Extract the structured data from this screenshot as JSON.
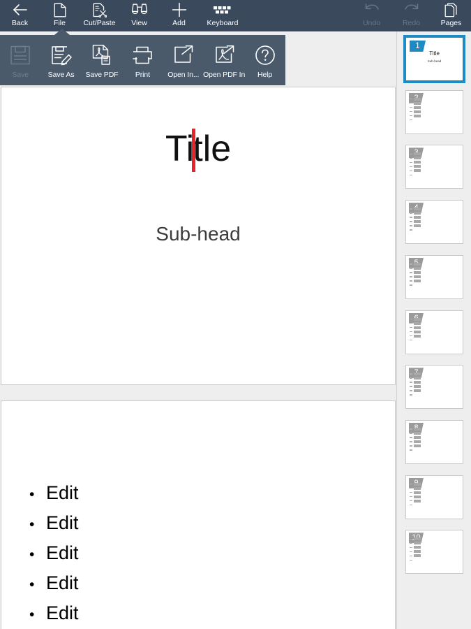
{
  "toolbar": {
    "left_items": [
      {
        "label": "Back",
        "icon": "arrow-left-icon",
        "disabled": false
      },
      {
        "label": "File",
        "icon": "document-icon",
        "disabled": false
      },
      {
        "label": "Cut/Paste",
        "icon": "cut-paste-icon",
        "disabled": false
      },
      {
        "label": "View",
        "icon": "binoculars-icon",
        "disabled": false
      },
      {
        "label": "Add",
        "icon": "plus-icon",
        "disabled": false
      },
      {
        "label": "Keyboard",
        "icon": "keyboard-icon",
        "disabled": false
      }
    ],
    "right_items": [
      {
        "label": "Undo",
        "icon": "undo-arrow-icon",
        "disabled": true
      },
      {
        "label": "Redo",
        "icon": "redo-arrow-icon",
        "disabled": true
      },
      {
        "label": "Pages",
        "icon": "pages-stack-icon",
        "disabled": false
      }
    ],
    "background_color": "#3a4a5c",
    "disabled_color": "#66778a"
  },
  "file_menu": {
    "open": true,
    "anchor": "File",
    "background_color": "#4a5a6b",
    "items": [
      {
        "label": "Save",
        "icon": "floppy-disk-icon",
        "disabled": true
      },
      {
        "label": "Save As",
        "icon": "save-as-pencil-icon",
        "disabled": false
      },
      {
        "label": "Save PDF",
        "icon": "save-pdf-icon",
        "disabled": false
      },
      {
        "label": "Print",
        "icon": "printer-icon",
        "disabled": false
      },
      {
        "label": "Open In...",
        "icon": "open-in-icon",
        "disabled": false
      },
      {
        "label": "Open PDF In",
        "icon": "open-pdf-in-icon",
        "disabled": false
      },
      {
        "label": "Help",
        "icon": "question-circle-icon",
        "disabled": false
      }
    ]
  },
  "editor": {
    "background_color": "#eeeeee",
    "slide1": {
      "title_before_caret": "Ti",
      "title_after_caret": "tle",
      "caret_color": "#e8232a",
      "subhead": "Sub-head"
    },
    "slide2": {
      "bullet_char": "•",
      "bullets": [
        "Edit",
        "Edit",
        "Edit",
        "Edit",
        "Edit"
      ]
    }
  },
  "sidebar": {
    "background_color": "#eeeeee",
    "selected_color": "#1d8ac4",
    "selected_page": 1,
    "thumbnails": [
      {
        "number": "1",
        "type": "title",
        "title": "Title",
        "subhead": "Sub-head"
      },
      {
        "number": "2",
        "type": "bullets"
      },
      {
        "number": "3",
        "type": "bullets"
      },
      {
        "number": "4",
        "type": "bullets"
      },
      {
        "number": "5",
        "type": "bullets"
      },
      {
        "number": "6",
        "type": "bullets"
      },
      {
        "number": "7",
        "type": "bullets"
      },
      {
        "number": "8",
        "type": "bullets"
      },
      {
        "number": "9",
        "type": "bullets"
      },
      {
        "number": "10",
        "type": "bullets"
      }
    ]
  }
}
